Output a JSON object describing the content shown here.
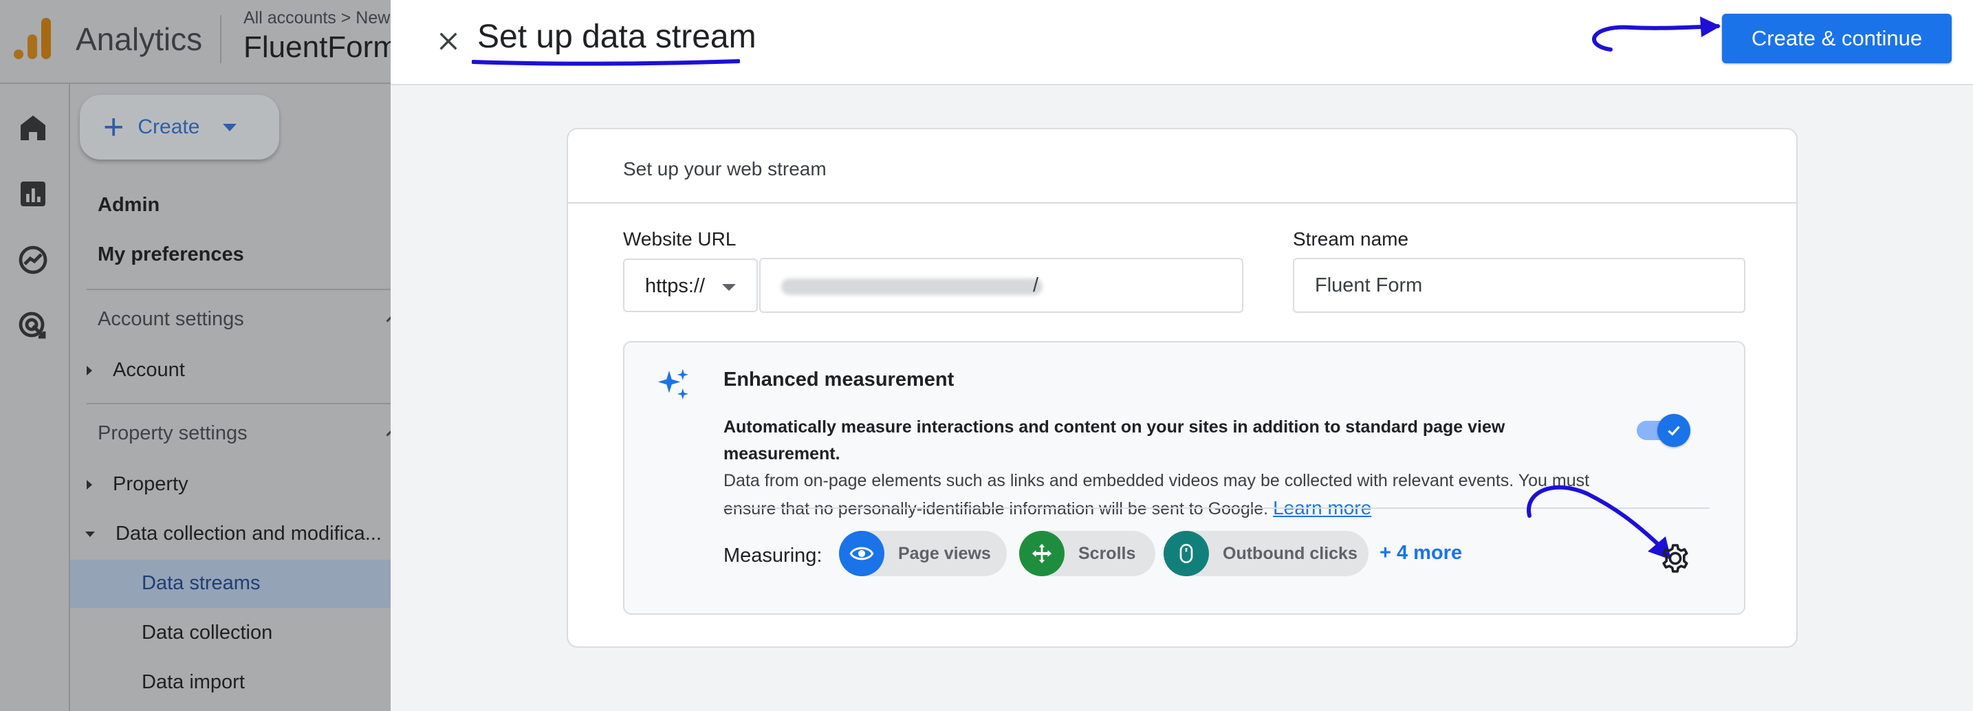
{
  "app": {
    "name": "Analytics",
    "breadcrumb": "All accounts > New",
    "property_title": "FluentForm"
  },
  "nav": {
    "create_label": "Create",
    "admin": "Admin",
    "my_preferences": "My preferences",
    "account_settings": "Account settings",
    "account": "Account",
    "property_settings": "Property settings",
    "property": "Property",
    "data_collection_modification": "Data collection and modifica...",
    "data_streams": "Data streams",
    "data_collection": "Data collection",
    "data_import": "Data import"
  },
  "panel": {
    "title": "Set up data stream",
    "primary_button": "Create & continue"
  },
  "card": {
    "header": "Set up your web stream",
    "website_url_label": "Website URL",
    "protocol_selected": "https://",
    "url_value_visible": "/",
    "stream_name_label": "Stream name",
    "stream_name_value": "Fluent Form"
  },
  "enhanced": {
    "title": "Enhanced measurement",
    "desc_bold": "Automatically measure interactions and content on your sites in addition to standard page view measurement.",
    "desc_rest": "Data from on-page elements such as links and embedded videos may be collected with relevant events. You must ensure that no personally-identifiable information will be sent to Google.",
    "learn_more": "Learn more",
    "toggle_on": true,
    "measuring_label": "Measuring:",
    "chips": [
      {
        "label": "Page views",
        "icon": "eye-icon",
        "color": "#1a73e8"
      },
      {
        "label": "Scrolls",
        "icon": "scroll-move-icon",
        "color": "#1e8e3e"
      },
      {
        "label": "Outbound clicks",
        "icon": "mouse-icon",
        "color": "#12807a"
      }
    ],
    "more_link": "+ 4 more"
  },
  "colors": {
    "accent": "#1a73e8",
    "annotation": "#1d10d6",
    "overlay_bg": "#a9abad"
  }
}
